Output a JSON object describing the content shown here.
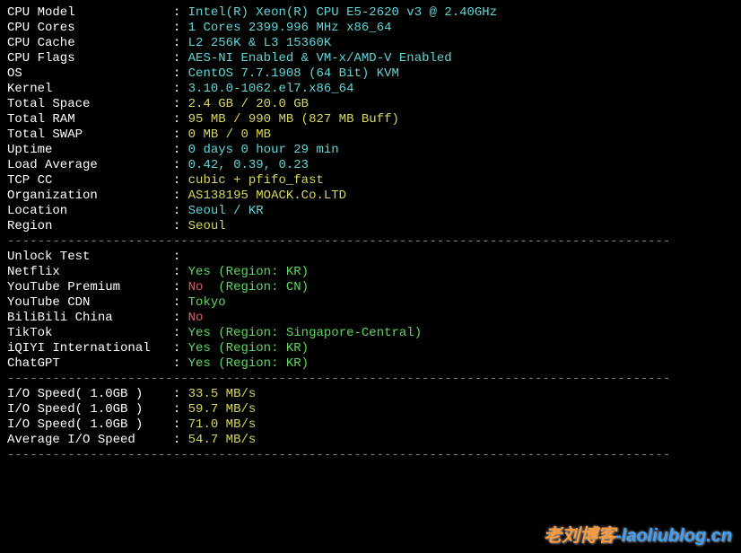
{
  "dash": "----------------------------------------------------------------------------------------",
  "sysinfo": [
    {
      "label": "CPU Model",
      "value": "Intel(R) Xeon(R) CPU E5-2620 v3 @ 2.40GHz",
      "color": "cyan"
    },
    {
      "label": "CPU Cores",
      "value": "1 Cores 2399.996 MHz x86_64",
      "color": "cyan"
    },
    {
      "label": "CPU Cache",
      "value": "L2 256K & L3 15360K",
      "color": "cyan"
    },
    {
      "label": "CPU Flags",
      "value": "AES-NI Enabled & VM-x/AMD-V Enabled",
      "color": "cyan"
    },
    {
      "label": "OS",
      "value": "CentOS 7.7.1908 (64 Bit) KVM",
      "color": "cyan"
    },
    {
      "label": "Kernel",
      "value": "3.10.0-1062.el7.x86_64",
      "color": "cyan"
    },
    {
      "label": "Total Space",
      "value": "2.4 GB / 20.0 GB",
      "color": "yellow"
    },
    {
      "label": "Total RAM",
      "value": "95 MB / 990 MB (827 MB Buff)",
      "color": "yellow"
    },
    {
      "label": "Total SWAP",
      "value": "0 MB / 0 MB",
      "color": "yellow"
    },
    {
      "label": "Uptime",
      "value": "0 days 0 hour 29 min",
      "color": "cyan"
    },
    {
      "label": "Load Average",
      "value": "0.42, 0.39, 0.23",
      "color": "cyan"
    },
    {
      "label": "TCP CC",
      "value": "cubic + pfifo_fast",
      "color": "yellow"
    },
    {
      "label": "Organization",
      "value": "AS138195 MOACK.Co.LTD",
      "color": "yellow"
    },
    {
      "label": "Location",
      "value": "Seoul / KR",
      "color": "cyan"
    },
    {
      "label": "Region",
      "value": "Seoul",
      "color": "yellow"
    }
  ],
  "unlock_header": {
    "label": "Unlock Test",
    "value": ""
  },
  "unlock": [
    {
      "label": "Netflix",
      "status": "Yes",
      "status_color": "green",
      "extra": "(Region: KR)"
    },
    {
      "label": "YouTube Premium",
      "status": "No",
      "status_color": "red",
      "extra": "(Region: CN)"
    },
    {
      "label": "YouTube CDN",
      "status": "Tokyo",
      "status_color": "green",
      "extra": ""
    },
    {
      "label": "BiliBili China",
      "status": "No",
      "status_color": "red",
      "extra": ""
    },
    {
      "label": "TikTok",
      "status": "Yes",
      "status_color": "green",
      "extra": "(Region: Singapore-Central)"
    },
    {
      "label": "iQIYI International",
      "status": "Yes",
      "status_color": "green",
      "extra": "(Region: KR)"
    },
    {
      "label": "ChatGPT",
      "status": "Yes",
      "status_color": "green",
      "extra": "(Region: KR)"
    }
  ],
  "io": [
    {
      "label": "I/O Speed( 1.0GB )",
      "value": "33.5 MB/s"
    },
    {
      "label": "I/O Speed( 1.0GB )",
      "value": "59.7 MB/s"
    },
    {
      "label": "I/O Speed( 1.0GB )",
      "value": "71.0 MB/s"
    },
    {
      "label": "Average I/O Speed",
      "value": "54.7 MB/s"
    }
  ],
  "watermark": {
    "part1": "老刘博客",
    "part2": "-laoliublog.cn"
  }
}
